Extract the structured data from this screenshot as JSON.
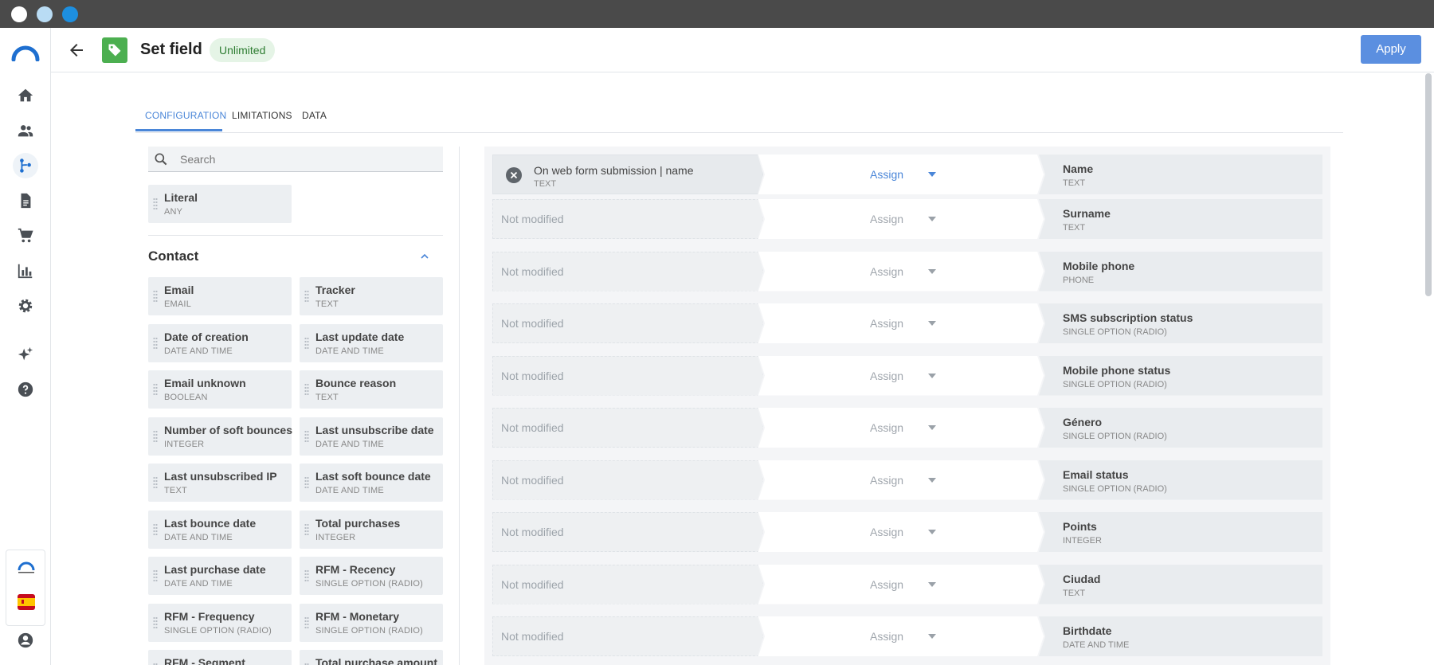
{
  "header": {
    "title": "Set field",
    "badge": "Unlimited",
    "apply_label": "Apply"
  },
  "tabs": [
    {
      "label": "CONFIGURATION",
      "active": true
    },
    {
      "label": "LIMITATIONS"
    },
    {
      "label": "DATA"
    }
  ],
  "search": {
    "placeholder": "Search"
  },
  "literal": {
    "title": "Literal",
    "type": "ANY"
  },
  "contact_section": {
    "title": "Contact"
  },
  "fields": [
    {
      "title": "Email",
      "type": "EMAIL"
    },
    {
      "title": "Tracker",
      "type": "TEXT"
    },
    {
      "title": "Date of creation",
      "type": "DATE AND TIME"
    },
    {
      "title": "Last update date",
      "type": "DATE AND TIME"
    },
    {
      "title": "Email unknown",
      "type": "BOOLEAN"
    },
    {
      "title": "Bounce reason",
      "type": "TEXT"
    },
    {
      "title": "Number of soft bounces",
      "type": "INTEGER"
    },
    {
      "title": "Last unsubscribe date",
      "type": "DATE AND TIME"
    },
    {
      "title": "Last unsubscribed IP",
      "type": "TEXT"
    },
    {
      "title": "Last soft bounce date",
      "type": "DATE AND TIME"
    },
    {
      "title": "Last bounce date",
      "type": "DATE AND TIME"
    },
    {
      "title": "Total purchases",
      "type": "INTEGER"
    },
    {
      "title": "Last purchase date",
      "type": "DATE AND TIME"
    },
    {
      "title": "RFM - Recency",
      "type": "SINGLE OPTION (RADIO)"
    },
    {
      "title": "RFM - Frequency",
      "type": "SINGLE OPTION (RADIO)"
    },
    {
      "title": "RFM - Monetary",
      "type": "SINGLE OPTION (RADIO)"
    },
    {
      "title": "RFM - Segment",
      "type": ""
    },
    {
      "title": "Total purchase amount",
      "type": ""
    }
  ],
  "mappings": [
    {
      "source": "On web form submission | name",
      "source_type": "TEXT",
      "operation": "Assign",
      "target": "Name",
      "target_type": "TEXT"
    },
    {
      "source": "Not modified",
      "source_type": "",
      "operation": "Assign",
      "target": "Surname",
      "target_type": "TEXT"
    },
    {
      "source": "Not modified",
      "source_type": "",
      "operation": "Assign",
      "target": "Mobile phone",
      "target_type": "PHONE"
    },
    {
      "source": "Not modified",
      "source_type": "",
      "operation": "Assign",
      "target": "SMS subscription status",
      "target_type": "SINGLE OPTION (RADIO)"
    },
    {
      "source": "Not modified",
      "source_type": "",
      "operation": "Assign",
      "target": "Mobile phone status",
      "target_type": "SINGLE OPTION (RADIO)"
    },
    {
      "source": "Not modified",
      "source_type": "",
      "operation": "Assign",
      "target": "Género",
      "target_type": "SINGLE OPTION (RADIO)"
    },
    {
      "source": "Not modified",
      "source_type": "",
      "operation": "Assign",
      "target": "Email status",
      "target_type": "SINGLE OPTION (RADIO)"
    },
    {
      "source": "Not modified",
      "source_type": "",
      "operation": "Assign",
      "target": "Points",
      "target_type": "INTEGER"
    },
    {
      "source": "Not modified",
      "source_type": "",
      "operation": "Assign",
      "target": "Ciudad",
      "target_type": "TEXT"
    },
    {
      "source": "Not modified",
      "source_type": "",
      "operation": "Assign",
      "target": "Birthdate",
      "target_type": "DATE AND TIME"
    }
  ],
  "sidebar": {
    "items": [
      "home-icon",
      "contacts-icon",
      "flows-icon",
      "documents-icon",
      "cart-icon",
      "reports-icon",
      "settings-icon",
      "ai-sparkle-icon",
      "help-icon"
    ],
    "bottom": [
      "connectif-logo-icon",
      "spain-flag-icon",
      "account-icon"
    ]
  },
  "colors": {
    "accent": "#5b8fe0",
    "tag": "#4caf50",
    "badge_bg": "#e5f4e6",
    "badge_text": "#2e7d32"
  }
}
